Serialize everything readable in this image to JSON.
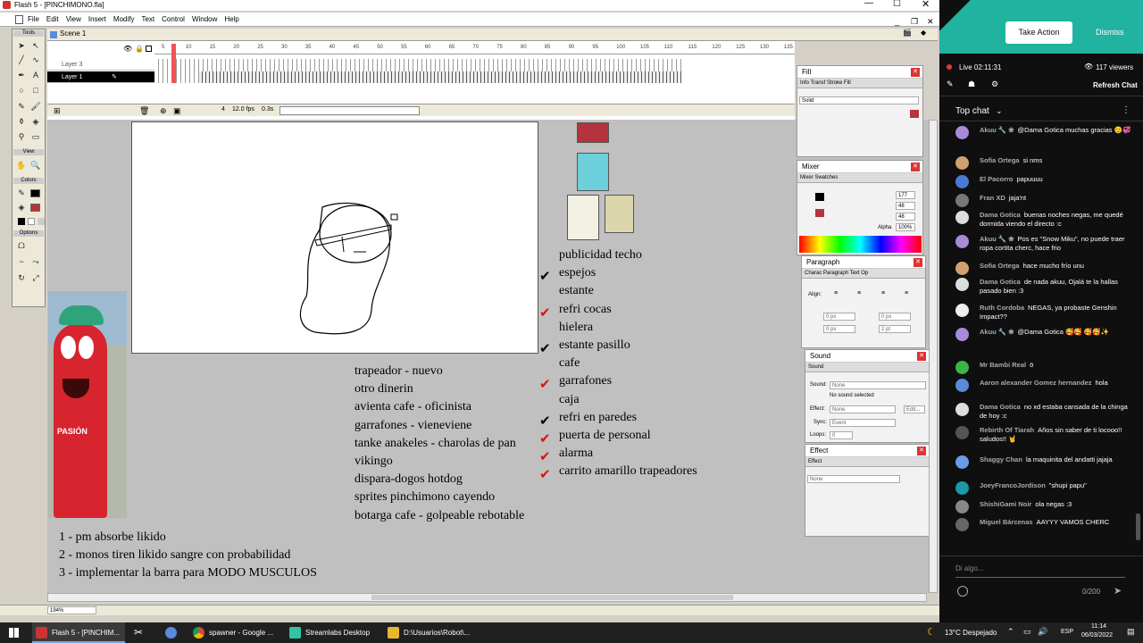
{
  "window": {
    "title": "Flash 5 - [PINCHIMONO.fla]"
  },
  "menu": [
    "File",
    "Edit",
    "View",
    "Insert",
    "Modify",
    "Text",
    "Control",
    "Window",
    "Help"
  ],
  "scene": {
    "label": "Scene 1"
  },
  "toolbox": {
    "tools_label": "Tools",
    "view_label": "View",
    "colors_label": "Colors",
    "options_label": "Options"
  },
  "timeline": {
    "layers": [
      {
        "name": "Layer 3"
      },
      {
        "name": "Layer 1"
      }
    ],
    "ruler": [
      "5",
      "10",
      "15",
      "20",
      "25",
      "30",
      "35",
      "40",
      "45",
      "50",
      "55",
      "60",
      "65",
      "70",
      "75",
      "80",
      "85",
      "90",
      "95",
      "100",
      "105",
      "110",
      "115",
      "120",
      "125",
      "130",
      "135"
    ],
    "frame": "4",
    "fps": "12.0 fps",
    "time": "0.3s"
  },
  "colors": {
    "accent": "#b5333c",
    "cyan": "#6dcfd9",
    "cream": "#f3f1e4",
    "beige": "#dcd6ad"
  },
  "checklist": [
    {
      "text": "publicidad techo",
      "mark": ""
    },
    {
      "text": "espejos",
      "mark": "✔",
      "color": "#000"
    },
    {
      "text": "estante",
      "mark": ""
    },
    {
      "text": "refri cocas",
      "mark": "✔",
      "color": "#d11"
    },
    {
      "text": "hielera",
      "mark": ""
    },
    {
      "text": "estante pasillo",
      "mark": "✔",
      "color": "#000"
    },
    {
      "text": "cafe",
      "mark": ""
    },
    {
      "text": "garrafones",
      "mark": "✔",
      "color": "#d11"
    },
    {
      "text": "caja",
      "mark": ""
    },
    {
      "text": "refri en paredes",
      "mark": "✔",
      "color": "#000"
    },
    {
      "text": "puerta de personal",
      "mark": "✔",
      "color": "#d11"
    },
    {
      "text": "alarma",
      "mark": "✔",
      "color": "#d11"
    },
    {
      "text": "carrito amarillo trapeadores",
      "mark": "✔",
      "color": "#d11"
    }
  ],
  "ideas": [
    "trapeador - nuevo",
    "otro dinerin",
    "avienta cafe - oficinista",
    "garrafones - vieneviene",
    "tanke anakeles - charolas de pan",
    "vikingo",
    "dispara-dogos hotdog",
    "sprites pinchimono cayendo",
    "botarga cafe - golpeable rebotable"
  ],
  "todos": [
    "1 - pm absorbe likido",
    "2 - monos tiren likido sangre con probabilidad",
    "3 - implementar la barra para MODO MUSCULOS"
  ],
  "mascot": {
    "text": "PASIÓN"
  },
  "panels": {
    "fill": {
      "title": "Fill",
      "tabs": "Info  Transf  Stroke  Fill",
      "value": "Solid"
    },
    "mixer": {
      "title": "Mixer",
      "tabs": "Mixer  Swatches",
      "r": "177",
      "g": "48",
      "b": "48",
      "alpha_label": "Alpha",
      "alpha": "100%"
    },
    "paragraph": {
      "title": "Paragraph",
      "tabs": "Charac  Paragraph  Text Op",
      "align": "Align:",
      "v1": "0 px",
      "v2": "0 px",
      "v3": "0 px",
      "v4": "2 pt"
    },
    "sound": {
      "title": "Sound",
      "tab": "Sound",
      "sound_label": "Sound:",
      "sound_value": "None",
      "status": "No sound selected",
      "effect_label": "Effect:",
      "effect_value": "None",
      "edit": "Edit...",
      "sync_label": "Sync:",
      "sync_value": "Event",
      "loops_label": "Loops:",
      "loops_value": "0"
    },
    "effect": {
      "title": "Effect",
      "tab": "Effect",
      "value": "None"
    }
  },
  "zoom": "194%",
  "taskbar": {
    "items": [
      "Flash 5 - [PINCHIM...",
      "spawner - Google ...",
      "Streamlabs Desktop",
      "D:\\Usuarios\\Robot\\..."
    ],
    "weather": "13°C Despejado",
    "lang": "ESP",
    "time": "11:14",
    "date": "06/03/2022"
  },
  "chat": {
    "take_action": "Take Action",
    "dismiss": "Dismiss",
    "live": "Live 02:11:31",
    "viewers": "117 viewers",
    "refresh": "Refresh Chat",
    "top_chat": "Top chat",
    "placeholder": "Di algo...",
    "counter": "0/200",
    "messages": [
      {
        "author": "Akuu 🔧 ❀",
        "text": "@Dama Gotica muchas gracias 😊💞",
        "color": "#a78ad8"
      },
      {
        "author": "Sofia Ortega",
        "text": "si nms",
        "color": "#d0a070"
      },
      {
        "author": "El Pacorro",
        "text": "papuuuu",
        "color": "#4a7ad0"
      },
      {
        "author": "Fran XD",
        "text": "jaja'nt",
        "color": "#777"
      },
      {
        "author": "Dama Gotica",
        "text": "buenas noches negas, me quedé dormida viendo el directo :c",
        "color": "#ddd"
      },
      {
        "author": "Akuu 🔧 ❀",
        "text": "Pos es \"Snow Miku\", no puede traer ropa cortita cherc, hace frio",
        "color": "#a78ad8"
      },
      {
        "author": "Sofia Ortega",
        "text": "hace mucho frío unu",
        "color": "#d0a070"
      },
      {
        "author": "Dama Gotica",
        "text": "de nada akuu, Ojalá te la hallas pasado bien :3",
        "color": "#ddd"
      },
      {
        "author": "Ruth Cordoba",
        "text": "NEGAS, ya probaste Genshin Impact??",
        "color": "#eee"
      },
      {
        "author": "Akuu 🔧 ❀",
        "text": "@Dama Gotica 🥰🥰 🥰🥰✨",
        "color": "#a78ad8"
      },
      {
        "author": "Mr Bambi Real",
        "text": "ö",
        "color": "#3ab54a"
      },
      {
        "author": "Aaron alexander Gomez hernandez",
        "text": "hola",
        "color": "#5a8ad8"
      },
      {
        "author": "Dama Gotica",
        "text": "no xd estaba cansada de la chinga de hoy :c",
        "color": "#ddd"
      },
      {
        "author": "Rebirth Of Tiarah",
        "text": "Años sin saber de ti locooo!! saludos!! 🤘",
        "color": "#555"
      },
      {
        "author": "Shaggy Chan",
        "text": "la maquinita del andatti jajaja",
        "color": "#6a9ae8"
      },
      {
        "author": "JoeyFrancoJordison",
        "text": "\"shupi papu\"",
        "color": "#1a9aa8"
      },
      {
        "author": "ShishiGami Noir",
        "text": "ola negas :3",
        "color": "#888"
      },
      {
        "author": "Miguel Bárcenas",
        "text": "AAYYY VAMOS CHERC",
        "color": "#666"
      }
    ]
  }
}
